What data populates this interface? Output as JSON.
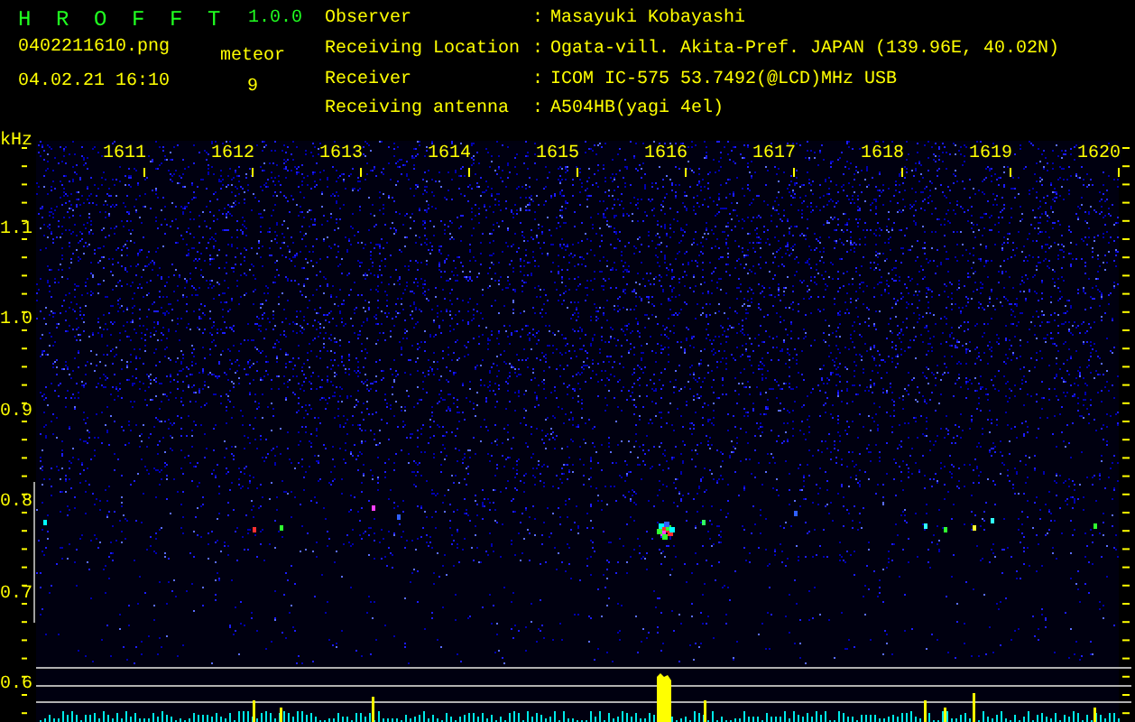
{
  "app": {
    "name": "H R O F F T",
    "version": "1.0.0"
  },
  "file": {
    "name": "0402211610.png",
    "datetime": "04.02.21 16:10"
  },
  "meteor": {
    "label": "meteor",
    "count": "9"
  },
  "info": [
    {
      "label": "Observer",
      "separator": ":",
      "value": "Masayuki Kobayashi"
    },
    {
      "label": "Receiving Location",
      "separator": ":",
      "value": "Ogata-vill. Akita-Pref. JAPAN (139.96E, 40.02N)"
    },
    {
      "label": "Receiver",
      "separator": ":",
      "value": "ICOM IC-575 53.7492(@LCD)MHz USB"
    },
    {
      "label": "Receiving antenna",
      "separator": ":",
      "value": "A504HB(yagi 4el)"
    }
  ],
  "plot": {
    "unit": "kHz",
    "x_labels": [
      "1611",
      "1612",
      "1613",
      "1614",
      "1615",
      "1616",
      "1617",
      "1618",
      "1619",
      "1620"
    ],
    "y_labels": [
      "1.1",
      "1.0",
      "0.9",
      "0.8",
      "0.7",
      "0.6"
    ]
  }
}
